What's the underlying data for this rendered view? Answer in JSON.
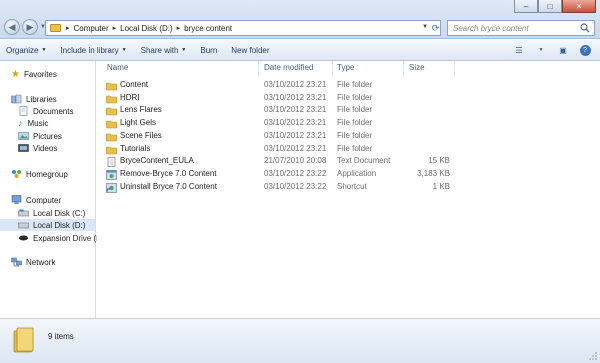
{
  "window": {
    "close_glyph": "✕",
    "minimize_glyph": "–",
    "maximize_glyph": "□"
  },
  "address": {
    "crumbs": [
      "Computer",
      "Local Disk (D:)",
      "bryce content"
    ],
    "separator": "▸",
    "refresh_icon": "refresh-icon"
  },
  "search": {
    "placeholder": "Search bryce content"
  },
  "toolbar": {
    "organize": "Organize",
    "include_in_library": "Include in library",
    "share_with": "Share with",
    "burn": "Burn",
    "new_folder": "New folder"
  },
  "sidebar": {
    "favorites": "Favorites",
    "libraries": "Libraries",
    "documents": "Documents",
    "music": "Music",
    "pictures": "Pictures",
    "videos": "Videos",
    "homegroup": "Homegroup",
    "computer": "Computer",
    "local_c": "Local Disk (C:)",
    "local_d": "Local Disk (D:)",
    "expansion": "Expansion Drive (F:)",
    "network": "Network"
  },
  "columns": {
    "name": "Name",
    "date": "Date modified",
    "type": "Type",
    "size": "Size"
  },
  "files": [
    {
      "name": "Content",
      "date": "03/10/2012 23:21",
      "type": "File folder",
      "size": "",
      "icon": "folder"
    },
    {
      "name": "HDRI",
      "date": "03/10/2012 23:21",
      "type": "File folder",
      "size": "",
      "icon": "folder"
    },
    {
      "name": "Lens Flares",
      "date": "03/10/2012 23:21",
      "type": "File folder",
      "size": "",
      "icon": "folder"
    },
    {
      "name": "Light Gels",
      "date": "03/10/2012 23:21",
      "type": "File folder",
      "size": "",
      "icon": "folder"
    },
    {
      "name": "Scene Files",
      "date": "03/10/2012 23:21",
      "type": "File folder",
      "size": "",
      "icon": "folder"
    },
    {
      "name": "Tutorials",
      "date": "03/10/2012 23:21",
      "type": "File folder",
      "size": "",
      "icon": "folder"
    },
    {
      "name": "BryceContent_EULA",
      "date": "21/07/2010 20:08",
      "type": "Text Document",
      "size": "15 KB",
      "icon": "text"
    },
    {
      "name": "Remove-Bryce 7.0 Content",
      "date": "03/10/2012 23:22",
      "type": "Application",
      "size": "3,183 KB",
      "icon": "app"
    },
    {
      "name": "Uninstall Bryce 7.0 Content",
      "date": "03/10/2012 23:22",
      "type": "Shortcut",
      "size": "1 KB",
      "icon": "shortcut"
    }
  ],
  "status": {
    "item_count": "9 items"
  }
}
